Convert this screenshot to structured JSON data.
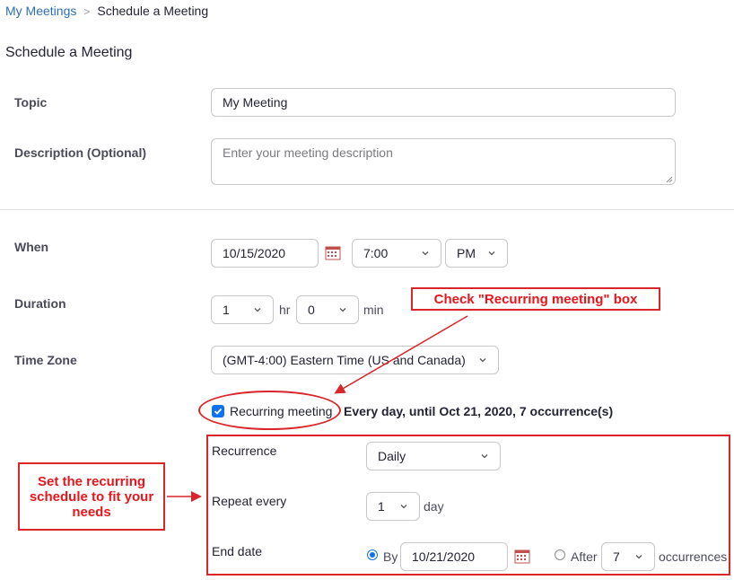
{
  "breadcrumb": {
    "root": "My Meetings",
    "separator": ">",
    "current": "Schedule a Meeting"
  },
  "page_title": "Schedule a Meeting",
  "topic": {
    "label": "Topic",
    "value": "My Meeting"
  },
  "description": {
    "label": "Description (Optional)",
    "placeholder": "Enter your meeting description"
  },
  "when": {
    "label": "When",
    "date": "10/15/2020",
    "time": "7:00",
    "ampm": "PM"
  },
  "duration": {
    "label": "Duration",
    "hours": "1",
    "hours_unit": "hr",
    "minutes": "0",
    "minutes_unit": "min"
  },
  "timezone": {
    "label": "Time Zone",
    "value": "(GMT-4:00) Eastern Time (US and Canada)"
  },
  "recurring": {
    "checked": true,
    "label": "Recurring meeting",
    "summary": "Every day, until Oct 21, 2020, 7 occurrence(s)"
  },
  "recurrence": {
    "label": "Recurrence",
    "value": "Daily",
    "repeat_label": "Repeat every",
    "repeat_value": "1",
    "repeat_unit": "day",
    "end_label": "End date",
    "by_label": "By",
    "by_date": "10/21/2020",
    "by_selected": true,
    "after_label": "After",
    "after_value": "7",
    "after_unit": "occurrences"
  },
  "annotations": {
    "check_box_note": "Check \"Recurring meeting\" box",
    "schedule_note": "Set the recurring schedule to fit your needs"
  },
  "colors": {
    "annotation_red": "#d9262a",
    "link_blue": "#2d6fb7",
    "control_blue": "#0e72ed"
  }
}
